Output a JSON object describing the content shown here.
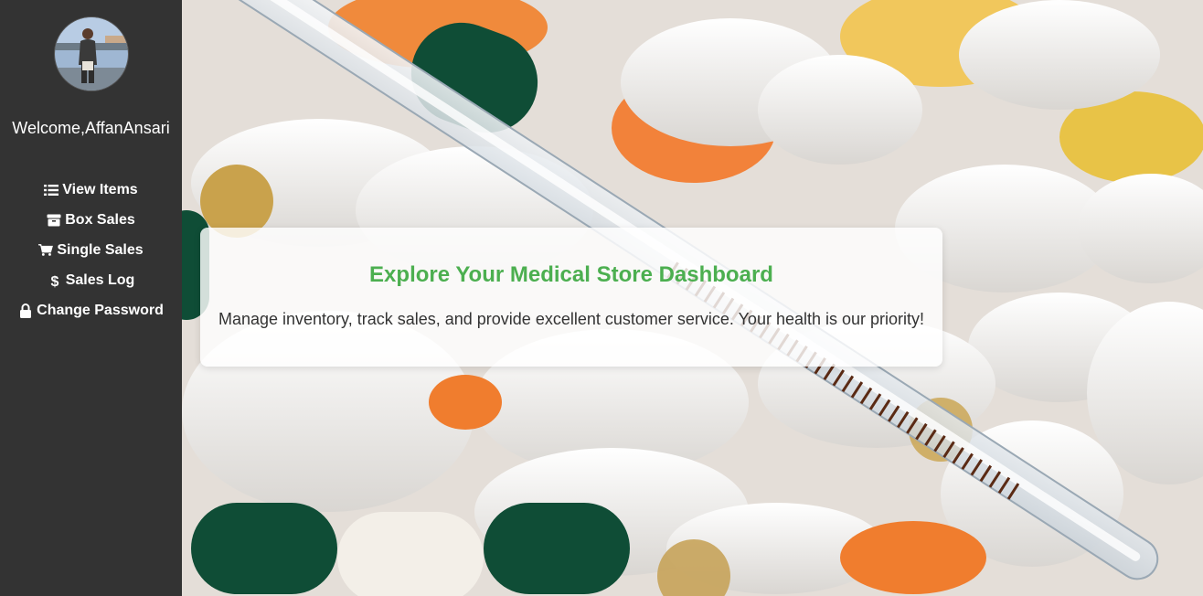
{
  "sidebar": {
    "welcome_text": "Welcome,AffanAnsari",
    "nav": [
      {
        "label": "View Items",
        "icon": "list-icon"
      },
      {
        "label": "Box Sales",
        "icon": "box-icon"
      },
      {
        "label": "Single Sales",
        "icon": "cart-icon"
      },
      {
        "label": "Sales Log",
        "icon": "dollar-icon"
      },
      {
        "label": "Change Password",
        "icon": "lock-icon"
      }
    ]
  },
  "hero": {
    "title": "Explore Your Medical Store Dashboard",
    "description": "Manage inventory, track sales, and provide excellent customer service. Your health is our priority!"
  },
  "colors": {
    "sidebar_bg": "#333333",
    "accent_green": "#4caf50",
    "text_dark": "#333333"
  }
}
